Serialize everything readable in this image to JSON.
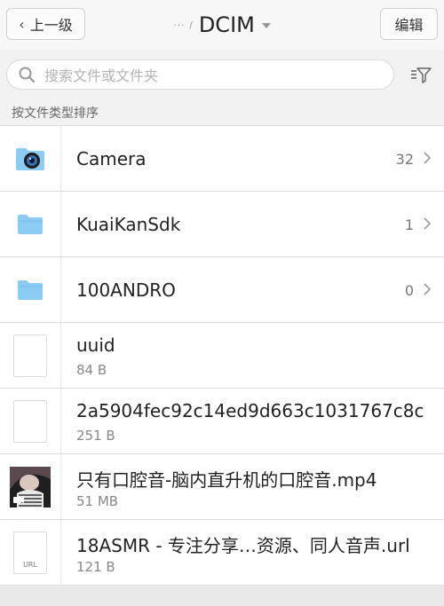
{
  "header": {
    "back_label": "上一级",
    "crumb": "··· /",
    "title": "DCIM",
    "edit_label": "编辑"
  },
  "search": {
    "placeholder": "搜索文件或文件夹"
  },
  "section": {
    "sort_label": "按文件类型排序"
  },
  "items": [
    {
      "type": "folder-camera",
      "name": "Camera",
      "count": "32"
    },
    {
      "type": "folder",
      "name": "KuaiKanSdk",
      "count": "1"
    },
    {
      "type": "folder",
      "name": "100ANDRO",
      "count": "0"
    },
    {
      "type": "file",
      "name": "uuid",
      "size": "84 B"
    },
    {
      "type": "file",
      "name": "2a5904fec92c14ed9d663c1031767c8c",
      "size": "251 B"
    },
    {
      "type": "video",
      "name": "只有口腔音-脑内直升机的口腔音.mp4",
      "size": "51 MB"
    },
    {
      "type": "url",
      "name": "18ASMR - 专注分享…资源、同人音声.url",
      "size": "121 B",
      "ext": "URL"
    }
  ],
  "colors": {
    "folder": "#8ccbf2",
    "accent": "#4aa3df"
  }
}
